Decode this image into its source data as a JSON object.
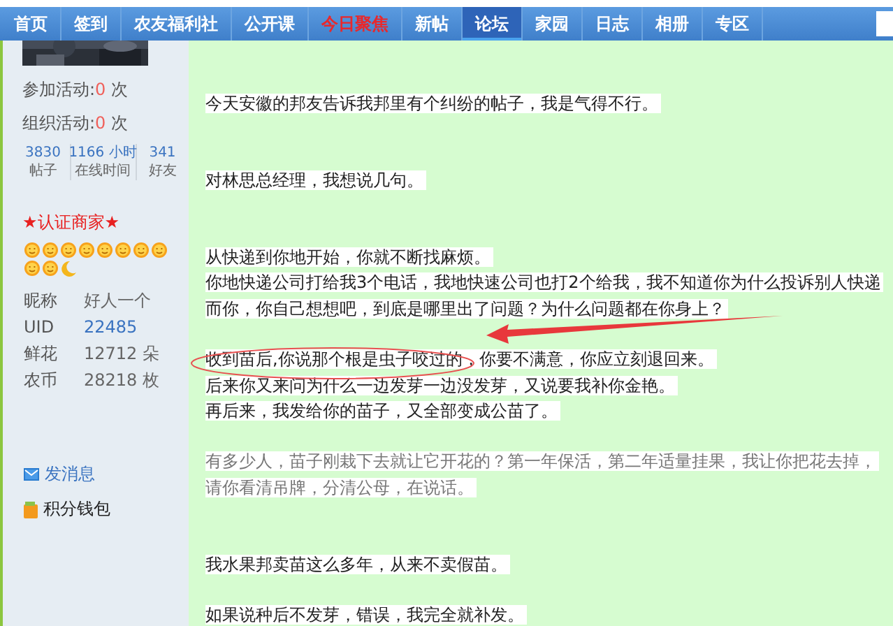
{
  "nav": {
    "items": [
      {
        "label": "首页",
        "selected": false,
        "highlight": false
      },
      {
        "label": "签到",
        "selected": false,
        "highlight": false
      },
      {
        "label": "农友福利社",
        "selected": false,
        "highlight": false
      },
      {
        "label": "公开课",
        "selected": false,
        "highlight": false
      },
      {
        "label": "今日聚焦",
        "selected": false,
        "highlight": true
      },
      {
        "label": "新帖",
        "selected": false,
        "highlight": false
      },
      {
        "label": "论坛",
        "selected": true,
        "highlight": false
      },
      {
        "label": "家园",
        "selected": false,
        "highlight": false
      },
      {
        "label": "日志",
        "selected": false,
        "highlight": false
      },
      {
        "label": "相册",
        "selected": false,
        "highlight": false
      },
      {
        "label": "专区",
        "selected": false,
        "highlight": false
      }
    ]
  },
  "sidebar": {
    "activities": [
      {
        "label": "参加活动:",
        "value": "0",
        "unit": "次"
      },
      {
        "label": "组织活动:",
        "value": "0",
        "unit": "次"
      }
    ],
    "stats": [
      {
        "value": "3830",
        "label": "帖子"
      },
      {
        "value": "1166 小时",
        "label": "在线时间"
      },
      {
        "value": "341",
        "label": "好友"
      }
    ],
    "badge": "★认证商家★",
    "level_icons": [
      {
        "kind": "sun"
      },
      {
        "kind": "sun"
      },
      {
        "kind": "sun"
      },
      {
        "kind": "sun"
      },
      {
        "kind": "sun"
      },
      {
        "kind": "sun"
      },
      {
        "kind": "sun"
      },
      {
        "kind": "sun"
      },
      {
        "kind": "sun"
      },
      {
        "kind": "sun"
      },
      {
        "kind": "moon"
      }
    ],
    "profile": [
      {
        "label": "昵称",
        "value": "好人一个",
        "link": false
      },
      {
        "label": "UID",
        "value": "22485",
        "link": true
      },
      {
        "label": "鲜花",
        "value": "12712 朵",
        "link": false
      },
      {
        "label": "农币",
        "value": "28218 枚",
        "link": false
      }
    ],
    "links": [
      {
        "kind": "message",
        "label": "发消息"
      },
      {
        "kind": "wallet",
        "label": "积分钱包"
      }
    ]
  },
  "post": {
    "lines": [
      {
        "kind": "blank"
      },
      {
        "kind": "text",
        "text": "今天安徽的邦友告诉我邦里有个纠纷的帖子，我是气得不行。",
        "muted": false
      },
      {
        "kind": "blank"
      },
      {
        "kind": "blank"
      },
      {
        "kind": "text",
        "text": "对林思总经理，我想说几句。",
        "muted": false
      },
      {
        "kind": "blank"
      },
      {
        "kind": "blank"
      },
      {
        "kind": "text",
        "text": "从快递到你地开始，你就不断找麻烦。",
        "muted": false
      },
      {
        "kind": "text",
        "text": "你地快递公司打给我3个电话，我地快速公司也打2个给我，我不知道你为什么投诉别人快递",
        "muted": false
      },
      {
        "kind": "text",
        "text": "而你，你自己想想吧，到底是哪里出了问题？为什么问题都在你身上？",
        "muted": false
      },
      {
        "kind": "blank"
      },
      {
        "kind": "text",
        "text": "收到苗后,你说那个根是虫子咬过的，你要不满意，你应立刻退回来。",
        "muted": false
      },
      {
        "kind": "text",
        "text": "后来你又来问为什么一边发芽一边没发芽，又说要我补你金艳。",
        "muted": false
      },
      {
        "kind": "text",
        "text": "再后来，我发给你的苗子，又全部变成公苗了。",
        "muted": false
      },
      {
        "kind": "blank"
      },
      {
        "kind": "text",
        "text": "有多少人，苗子刚栽下去就让它开花的？第一年保活，第二年适量挂果，我让你把花去掉，",
        "muted": true
      },
      {
        "kind": "text",
        "text": "请你看清吊牌，分清公母，在说话。",
        "muted": true
      },
      {
        "kind": "blank"
      },
      {
        "kind": "blank"
      },
      {
        "kind": "text",
        "text": "我水果邦卖苗这么多年，从来不卖假苗。",
        "muted": false
      },
      {
        "kind": "blank"
      },
      {
        "kind": "text",
        "text": "如果说种后不发芽，错误，我完全就补发。",
        "muted": false
      }
    ],
    "annotations": [
      {
        "kind": "ellipse"
      },
      {
        "kind": "arrow"
      }
    ]
  }
}
